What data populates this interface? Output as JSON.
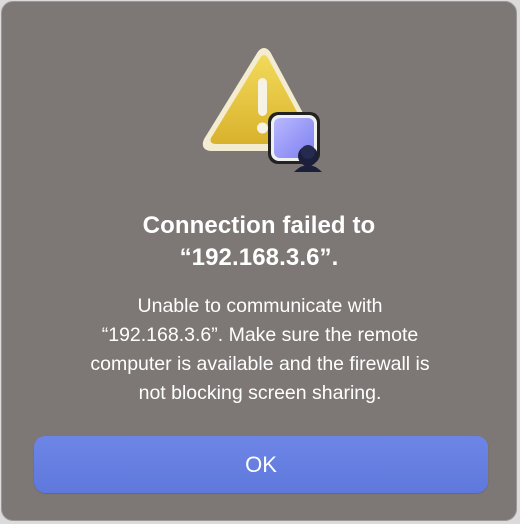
{
  "dialog": {
    "title_lines": [
      "Connection failed to",
      "“192.168.3.6”."
    ],
    "message_lines": [
      "Unable to communicate with",
      "“192.168.3.6”.  Make sure the remote",
      "computer is available and the firewall is",
      "not blocking screen sharing."
    ],
    "ok_label": "OK",
    "icon": "warning-triangle-icon",
    "badge_icon": "screen-sharing-icon"
  },
  "colors": {
    "dialog_background": "#7d7875",
    "button": "#6380e0",
    "warning": "#e8c53b",
    "text": "#ffffff"
  }
}
